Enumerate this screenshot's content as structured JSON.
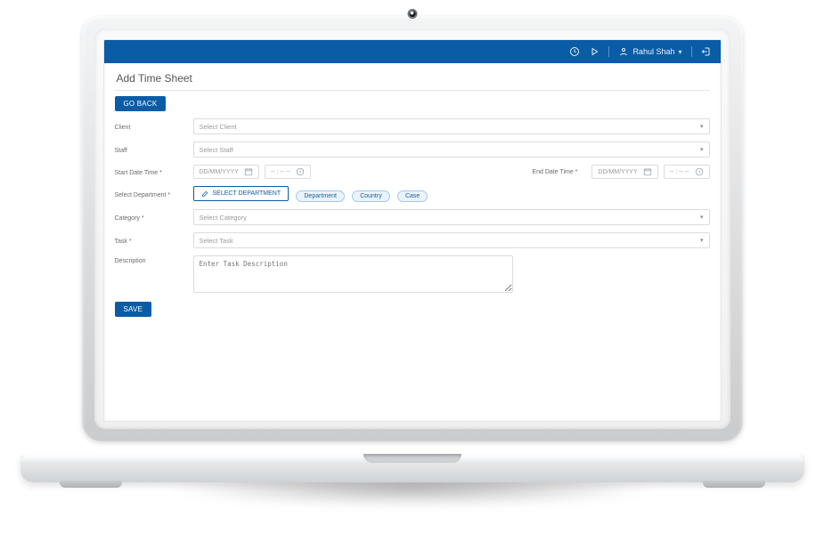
{
  "header": {
    "user_name": "Rahul Shah"
  },
  "page": {
    "title": "Add Time Sheet",
    "go_back_label": "GO BACK",
    "save_label": "SAVE"
  },
  "form": {
    "client": {
      "label": "Client",
      "placeholder": "Select Client"
    },
    "staff": {
      "label": "Staff",
      "placeholder": "Select Staff"
    },
    "start": {
      "label": "Start Date Time *",
      "date_placeholder": "DD/MM/YYYY",
      "time_placeholder": "-- : -- --"
    },
    "end": {
      "label": "End Date Time *",
      "date_placeholder": "DD/MM/YYYY",
      "time_placeholder": "-- : -- --"
    },
    "department": {
      "label": "Select Department *",
      "button_label": "SELECT DEPARTMENT",
      "chips": [
        "Department",
        "Country",
        "Case"
      ]
    },
    "category": {
      "label": "Category *",
      "placeholder": "Select Category"
    },
    "task": {
      "label": "Task *",
      "placeholder": "Select Task"
    },
    "description": {
      "label": "Description",
      "placeholder": "Enter Task Description"
    }
  }
}
